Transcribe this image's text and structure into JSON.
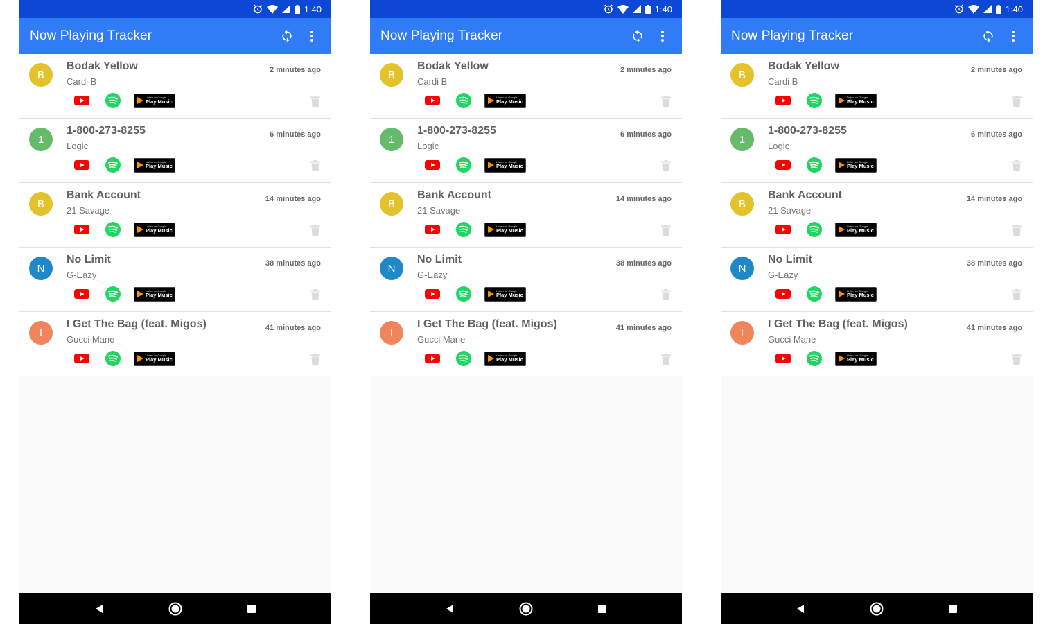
{
  "status_time": "1:40",
  "app_title": "Now Playing Tracker",
  "icons": {
    "refresh": "refresh-icon",
    "overflow": "more-vert-icon",
    "youtube": "youtube-icon",
    "spotify": "spotify-icon",
    "google_play": "google-play-music-badge",
    "delete": "trash-icon"
  },
  "badge": {
    "small": "Listen on Google",
    "big": "Play Music"
  },
  "colors": {
    "status_bar": "#0d47d6",
    "app_bar": "#2f7cf6",
    "youtube": "#ff0000",
    "spotify": "#1ed760"
  },
  "songs": [
    {
      "initial": "B",
      "color": "#e4c22b",
      "title": "Bodak Yellow",
      "artist": "Cardi B",
      "time": "2 minutes ago"
    },
    {
      "initial": "1",
      "color": "#66bb6a",
      "title": "1-800-273-8255",
      "artist": "Logic",
      "time": "6 minutes ago"
    },
    {
      "initial": "B",
      "color": "#e4c22b",
      "title": "Bank Account",
      "artist": "21 Savage",
      "time": "14 minutes ago"
    },
    {
      "initial": "N",
      "color": "#1e88c9",
      "title": "No Limit",
      "artist": "G-Eazy",
      "time": "38 minutes ago"
    },
    {
      "initial": "I",
      "color": "#f0845a",
      "title": "I Get The Bag (feat. Migos)",
      "artist": "Gucci Mane",
      "time": "41 minutes ago"
    }
  ]
}
